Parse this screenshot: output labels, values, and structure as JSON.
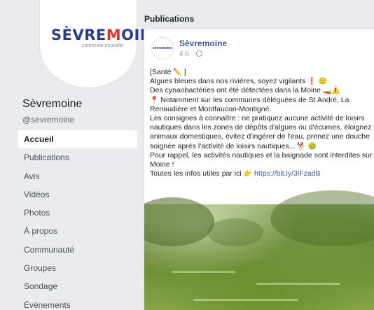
{
  "brand": {
    "logo_text_prefix": "SÈVRE",
    "logo_text_accent": "M",
    "logo_text_suffix": "OINE",
    "logo_subtitle": "commune nouvelle",
    "page_name": "Sèvremoine",
    "page_handle": "@sevremoine"
  },
  "nav": {
    "items": [
      {
        "label": "Accueil",
        "active": true
      },
      {
        "label": "Publications"
      },
      {
        "label": "Avis"
      },
      {
        "label": "Vidéos"
      },
      {
        "label": "Photos"
      },
      {
        "label": "À propos"
      },
      {
        "label": "Communauté"
      },
      {
        "label": "Groupes"
      },
      {
        "label": "Sondage"
      },
      {
        "label": "Évènements"
      }
    ]
  },
  "main": {
    "section_title": "Publications",
    "post": {
      "avatar_text": "sèvremoine",
      "author": "Sèvremoine",
      "time": "4 h ·",
      "lines": [
        "[Santé",
        "Algues bleues dans nos rivières, soyez vigilants",
        "Des cynaobactéries ont été détectées dans la Moine",
        "Notamment sur les communes déléguées de St André, La",
        "Renaudière et Montfaucon-Montigné.",
        "Les consignes à connaître : ne pratiquez aucune activité de loisirs",
        "nautiques dans les zones de dépôts d'algues ou d'écumes, éloignez les",
        "animaux domestiques, évitez d'ingérer de l'eau, prenez une douche",
        "soignée après l'activité de loisirs nautiques...",
        "Pour rappel, les activités nautiques et la baignade sont interdites sur la",
        "Moine !",
        "Toutes les infos utiles par ici"
      ],
      "link": "https://bit.ly/3iFzadB"
    }
  },
  "icons": {
    "pencil": "✏️",
    "exclamation": "❗",
    "worried": "😟",
    "boat": "🚤",
    "warning": "⚠️",
    "pin": "📍",
    "dog": "🐕",
    "sick": "🤢",
    "pointing": "👉"
  },
  "colors": {
    "brand_blue": "#2a3a8c",
    "brand_red": "#d9362b",
    "link": "#385898"
  }
}
